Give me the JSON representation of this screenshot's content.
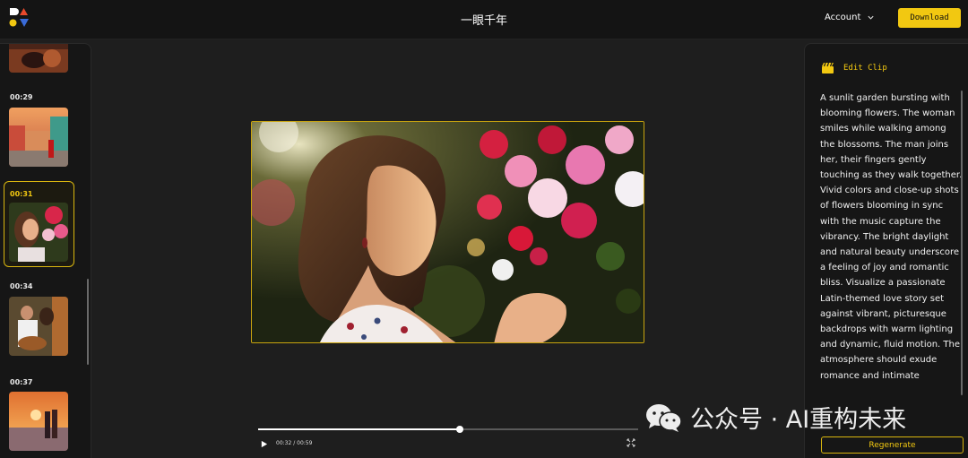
{
  "header": {
    "app_title": "一眼千年",
    "account_label": "Account",
    "download_label": "Download"
  },
  "sidebar": {
    "clips": [
      {
        "time": "",
        "thumb": "couple-at-dusk"
      },
      {
        "time": "00:29",
        "thumb": "colorful-street-woman-red-dress"
      },
      {
        "time": "00:31",
        "thumb": "woman-with-flowers",
        "active": true
      },
      {
        "time": "00:34",
        "thumb": "couple-guitar"
      },
      {
        "time": "00:37",
        "thumb": "beach-sunset-couple"
      }
    ]
  },
  "player": {
    "timecode": "00:32 / 00:59",
    "progress": 0.53
  },
  "edit_panel": {
    "title": "Edit Clip",
    "prompt": "A sunlit garden bursting with blooming flowers. The woman smiles while walking among the blossoms. The man joins her, their fingers gently touching as they walk together. Vivid colors and close-up shots of flowers blooming in sync with the music capture the vibrancy. The bright daylight and natural beauty underscore a feeling of joy and romantic bliss. Visualize a passionate Latin-themed love story set against vibrant, picturesque backdrops with warm lighting and dynamic, fluid motion. The atmosphere should exude romance and intimate",
    "regenerate_label": "Regenerate"
  },
  "watermark": {
    "text": "公众号 · AI重构未来"
  },
  "colors": {
    "accent": "#f2c811",
    "background": "#1e1e1e",
    "panel": "#161616"
  }
}
